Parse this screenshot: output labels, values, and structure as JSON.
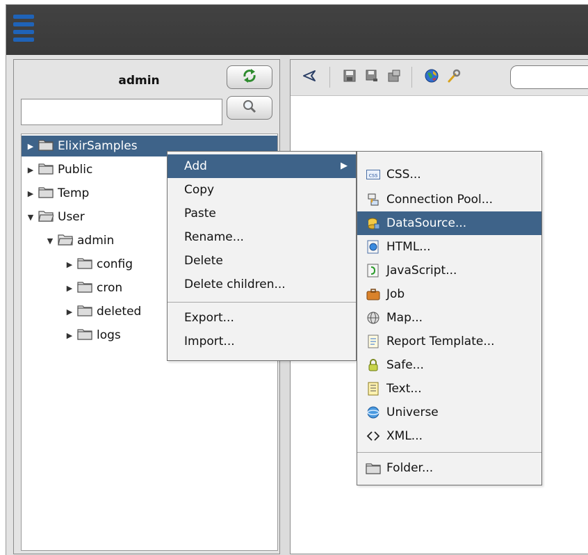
{
  "colors": {
    "titlebar": "#3c3c3c",
    "logo": "#1f63b8",
    "selection": "#3e6389",
    "menu_bg": "#f2f2f2",
    "folder": "#e2e2e2"
  },
  "left_panel": {
    "title": "admin",
    "search": {
      "value": "",
      "placeholder": ""
    },
    "refresh_icon": "refresh-icon",
    "search_icon": "magnifier-icon"
  },
  "tree": {
    "items": [
      {
        "label": "ElixirSamples",
        "expanded": false,
        "selected": true
      },
      {
        "label": "Public",
        "expanded": false
      },
      {
        "label": "Temp",
        "expanded": false
      },
      {
        "label": "User",
        "expanded": true
      },
      {
        "label": "admin",
        "expanded": true
      },
      {
        "label": "config",
        "expanded": false
      },
      {
        "label": "cron",
        "expanded": false
      },
      {
        "label": "deleted",
        "expanded": false
      },
      {
        "label": "logs",
        "expanded": false
      }
    ]
  },
  "toolbar": {
    "icons": [
      "back-icon",
      "save-icon",
      "save-as-icon",
      "properties-icon",
      "globe-icon",
      "wrench-icon"
    ],
    "path_value": ""
  },
  "context_menu": {
    "items": [
      {
        "label": "Add",
        "has_submenu": true,
        "active": true
      },
      {
        "label": "Copy"
      },
      {
        "label": "Paste"
      },
      {
        "label": "Rename..."
      },
      {
        "label": "Delete"
      },
      {
        "label": "Delete children..."
      },
      {
        "label": "Export..."
      },
      {
        "label": "Import..."
      }
    ]
  },
  "add_submenu": {
    "items": [
      {
        "label": "CSS...",
        "icon": "css-icon"
      },
      {
        "label": "Connection Pool...",
        "icon": "connection-pool-icon"
      },
      {
        "label": "DataSource...",
        "icon": "datasource-icon",
        "active": true
      },
      {
        "label": "HTML...",
        "icon": "html-icon"
      },
      {
        "label": "JavaScript...",
        "icon": "javascript-icon"
      },
      {
        "label": "Job",
        "icon": "job-icon"
      },
      {
        "label": "Map...",
        "icon": "map-icon"
      },
      {
        "label": "Report Template...",
        "icon": "report-template-icon"
      },
      {
        "label": "Safe...",
        "icon": "safe-icon"
      },
      {
        "label": "Text...",
        "icon": "text-icon"
      },
      {
        "label": "Universe",
        "icon": "universe-icon"
      },
      {
        "label": "XML...",
        "icon": "xml-icon"
      },
      {
        "label": "Folder...",
        "icon": "folder-icon"
      }
    ],
    "css_badge": "css"
  }
}
